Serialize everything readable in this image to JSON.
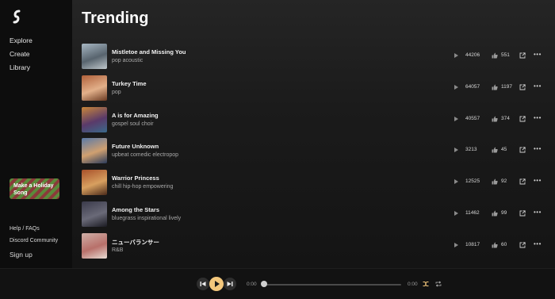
{
  "app": {
    "logo_icon": "suno-logo-icon"
  },
  "sidebar": {
    "nav": [
      {
        "label": "Explore"
      },
      {
        "label": "Create"
      },
      {
        "label": "Library"
      }
    ],
    "holiday_button": "Make a Holiday Song",
    "bottom_links": [
      {
        "label": "Help / FAQs"
      },
      {
        "label": "Discord Community"
      },
      {
        "label": "Sign up"
      }
    ]
  },
  "main": {
    "title": "Trending",
    "songs": [
      {
        "title": "Mistletoe and Missing You",
        "genre": "pop acoustic",
        "plays": "44206",
        "likes": "551",
        "thumb_colors": [
          "#a8b8c4",
          "#58646e",
          "#c0c8cc"
        ]
      },
      {
        "title": "Turkey Time",
        "genre": "pop",
        "plays": "64057",
        "likes": "1197",
        "thumb_colors": [
          "#b0603a",
          "#e2b08a",
          "#6a3a22"
        ]
      },
      {
        "title": "A is for Amazing",
        "genre": "gospel soul choir",
        "plays": "40557",
        "likes": "374",
        "thumb_colors": [
          "#c8863a",
          "#5a3a6a",
          "#3a6a8a"
        ]
      },
      {
        "title": "Future Unknown",
        "genre": "upbeat comedic electropop",
        "plays": "3213",
        "likes": "45",
        "thumb_colors": [
          "#5a7aa8",
          "#d0a070",
          "#2a3a5a"
        ]
      },
      {
        "title": "Warrior Princess",
        "genre": "chill hip-hop empowering",
        "plays": "12525",
        "likes": "92",
        "thumb_colors": [
          "#a8502a",
          "#d8a060",
          "#4a2a1a"
        ]
      },
      {
        "title": "Among the Stars",
        "genre": "bluegrass inspirational lively",
        "plays": "11462",
        "likes": "99",
        "thumb_colors": [
          "#3a3a4a",
          "#6a6a78",
          "#1a1a22"
        ]
      },
      {
        "title": "ニューバランサー",
        "genre": "R&B",
        "plays": "10817",
        "likes": "60",
        "thumb_colors": [
          "#d0b0a8",
          "#b8706a",
          "#e8dcd4"
        ]
      }
    ],
    "icons": {
      "play": "play-icon",
      "like": "thumbs-up-icon",
      "share": "share-icon",
      "more": "more-icon"
    }
  },
  "player": {
    "time_current": "0:00",
    "time_total": "0:00",
    "progress": 0,
    "icons": [
      "previous-icon",
      "play-icon",
      "next-icon",
      "shuffle-icon",
      "repeat-icon"
    ]
  },
  "colors": {
    "accent": "#f3c77c",
    "background": "#0a0a0a"
  }
}
